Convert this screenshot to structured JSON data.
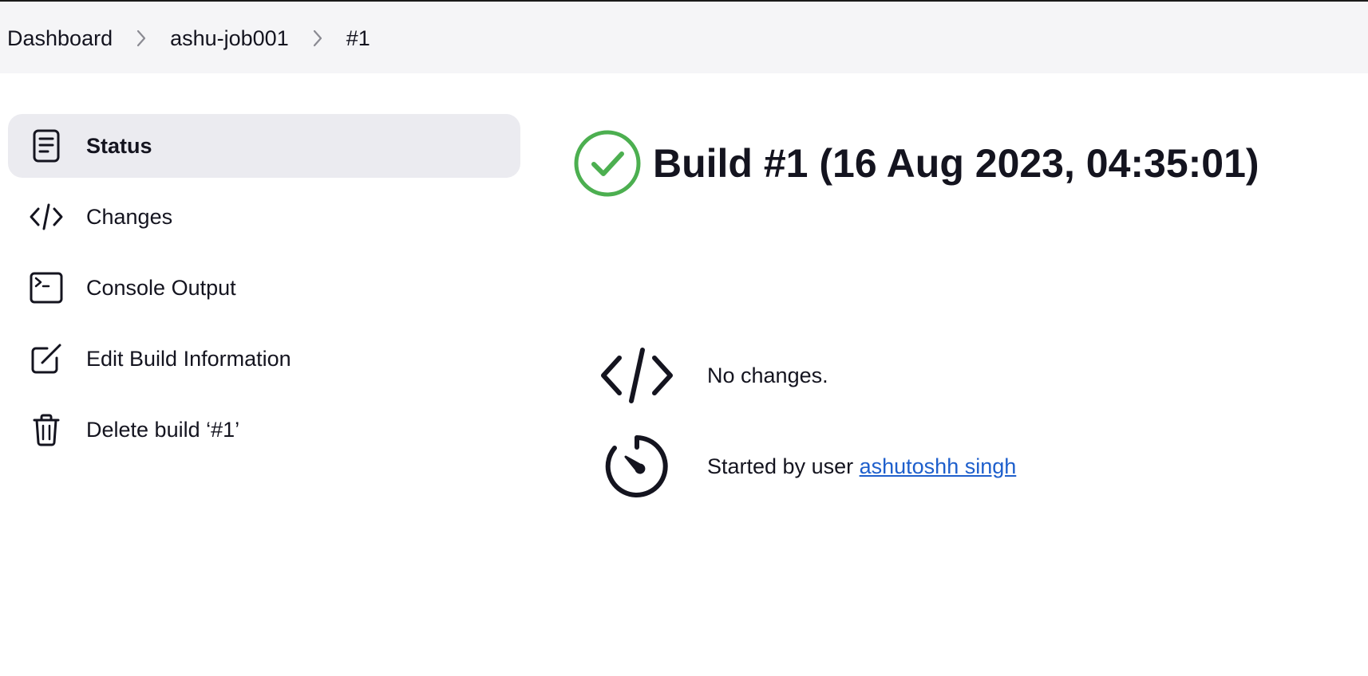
{
  "breadcrumb": {
    "items": [
      "Dashboard",
      "ashu-job001",
      "#1"
    ]
  },
  "sidebar": {
    "items": [
      {
        "label": "Status",
        "icon": "document-icon",
        "active": true
      },
      {
        "label": "Changes",
        "icon": "code-icon",
        "active": false
      },
      {
        "label": "Console Output",
        "icon": "terminal-icon",
        "active": false
      },
      {
        "label": "Edit Build Information",
        "icon": "edit-icon",
        "active": false
      },
      {
        "label": "Delete build ‘#1’",
        "icon": "trash-icon",
        "active": false
      }
    ]
  },
  "main": {
    "title": "Build #1 (16 Aug 2023, 04:35:01)",
    "status_icon": "success-check-icon",
    "status_color": "#4caf50",
    "changes_text": "No changes.",
    "started_prefix": "Started by user ",
    "started_user": "ashutoshh singh",
    "link_color": "#1e5fcc"
  }
}
